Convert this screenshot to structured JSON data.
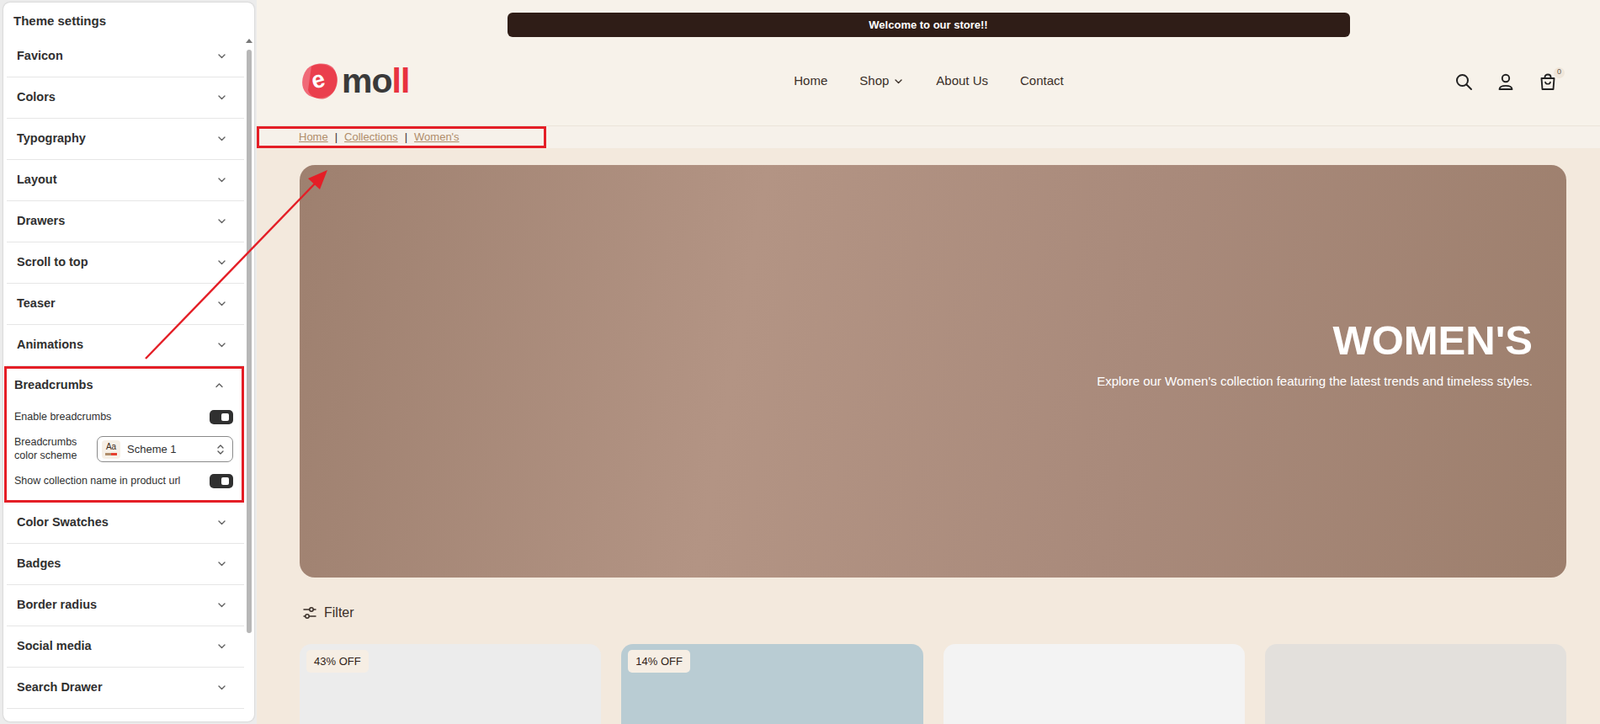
{
  "panel": {
    "title": "Theme settings",
    "sections": [
      {
        "label": "Favicon",
        "expanded": false
      },
      {
        "label": "Colors",
        "expanded": false
      },
      {
        "label": "Typography",
        "expanded": false
      },
      {
        "label": "Layout",
        "expanded": false
      },
      {
        "label": "Drawers",
        "expanded": false
      },
      {
        "label": "Scroll to top",
        "expanded": false
      },
      {
        "label": "Teaser",
        "expanded": false
      },
      {
        "label": "Animations",
        "expanded": false
      },
      {
        "label": "Breadcrumbs",
        "expanded": true,
        "settings": [
          {
            "kind": "toggle",
            "label": "Enable breadcrumbs",
            "on": true
          },
          {
            "kind": "select",
            "label": "Breadcrumbs color scheme",
            "value": "Scheme 1",
            "swatch": "Aa"
          },
          {
            "kind": "toggle",
            "label": "Show collection name in product url",
            "on": true
          }
        ]
      },
      {
        "label": "Color Swatches",
        "expanded": false
      },
      {
        "label": "Badges",
        "expanded": false
      },
      {
        "label": "Border radius",
        "expanded": false
      },
      {
        "label": "Social media",
        "expanded": false
      },
      {
        "label": "Search Drawer",
        "expanded": false
      }
    ]
  },
  "store": {
    "announcement": "Welcome to our store!!",
    "logo": {
      "mark": "e",
      "text": "mo",
      "accent": "ll"
    },
    "nav": [
      {
        "label": "Home",
        "has_menu": false
      },
      {
        "label": "Shop",
        "has_menu": true
      },
      {
        "label": "About Us",
        "has_menu": false
      },
      {
        "label": "Contact",
        "has_menu": false
      }
    ],
    "cart_count": "0",
    "breadcrumb_separator": "|",
    "breadcrumbs": [
      "Home",
      "Collections",
      "Women's"
    ],
    "hero": {
      "title": "WOMEN'S",
      "subtitle": "Explore our Women's collection featuring the latest trends and timeless styles."
    },
    "filter": "Filter",
    "products": [
      {
        "badge": "43% OFF"
      },
      {
        "badge": "14% OFF"
      },
      {
        "badge": ""
      },
      {
        "badge": ""
      }
    ]
  }
}
